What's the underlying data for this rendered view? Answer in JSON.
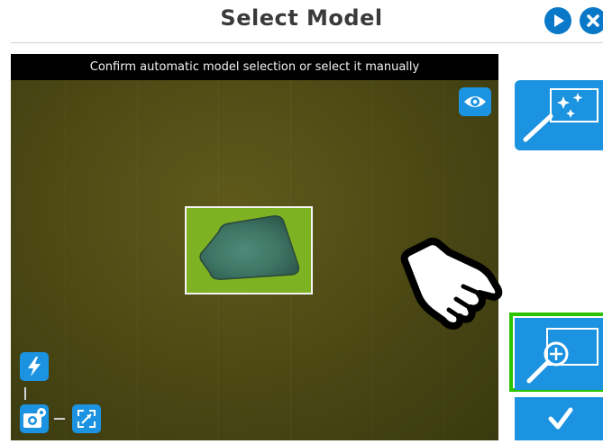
{
  "header": {
    "title": "Select Model",
    "next_icon": "play-circle-icon",
    "close_icon": "close-circle-icon"
  },
  "camera": {
    "instruction": "Confirm automatic model selection or select it manually",
    "eye_icon": "eye-icon",
    "flash_icon": "lightning-icon",
    "camera_settings_icon": "camera-settings-icon",
    "fit_icon": "expand-icon"
  },
  "side_panel": {
    "auto_select_icon": "magic-wand-icon",
    "manual_select_icon": "zoom-in-icon",
    "confirm_icon": "checkmark-icon"
  },
  "overlay": {
    "pointer_icon": "pointing-hand-icon"
  },
  "colors": {
    "accent": "#1b93e0",
    "highlight": "#2ac400",
    "title": "#3a3a3a"
  }
}
